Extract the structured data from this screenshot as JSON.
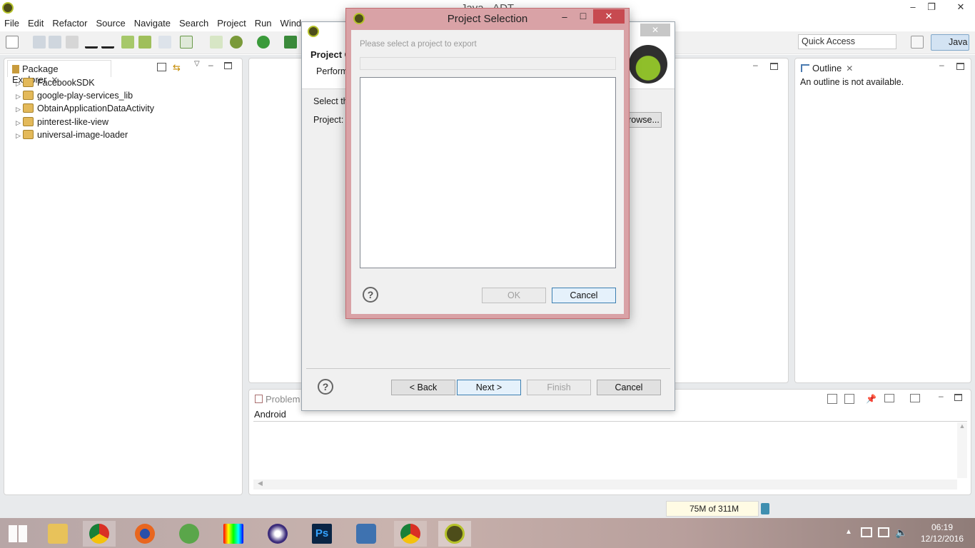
{
  "window": {
    "title": "Java - ADT",
    "minimize": "–",
    "maximize": "❐",
    "close": "✕"
  },
  "menu": [
    "File",
    "Edit",
    "Refactor",
    "Source",
    "Navigate",
    "Search",
    "Project",
    "Run",
    "Window"
  ],
  "toolbar": {
    "quick_access_placeholder": "Quick Access",
    "perspective_label": "Java"
  },
  "package_explorer": {
    "tab_label": "Package Explorer",
    "projects": [
      "FacebookSDK",
      "google-play-services_lib",
      "ObtainApplicationDataActivity",
      "pinterest-like-view",
      "universal-image-loader"
    ]
  },
  "outline": {
    "tab_label": "Outline",
    "message": "An outline is not available."
  },
  "problems": {
    "tab_label": "Problem",
    "row_label": "Android"
  },
  "status": {
    "memory": "75M of 311M"
  },
  "wizard": {
    "page_title": "Project C",
    "page_desc": "Perform",
    "select_text": "Select th",
    "project_label": "Project:",
    "browse_label": "rowse...",
    "help": "?",
    "back": "< Back",
    "next": "Next >",
    "finish": "Finish",
    "cancel": "Cancel",
    "close": "✕"
  },
  "dialog": {
    "title": "Project Selection",
    "instruction": "Please select a project to export",
    "help": "?",
    "ok": "OK",
    "cancel": "Cancel",
    "minimize": "–",
    "maximize": "□",
    "close": "✕"
  },
  "clock": {
    "time": "06:19",
    "date": "12/12/2016"
  },
  "colors": {
    "dialog_frame": "#d9a2a6",
    "accent_blue": "#3c7fb1",
    "workbench_bg": "#e8eaec"
  }
}
